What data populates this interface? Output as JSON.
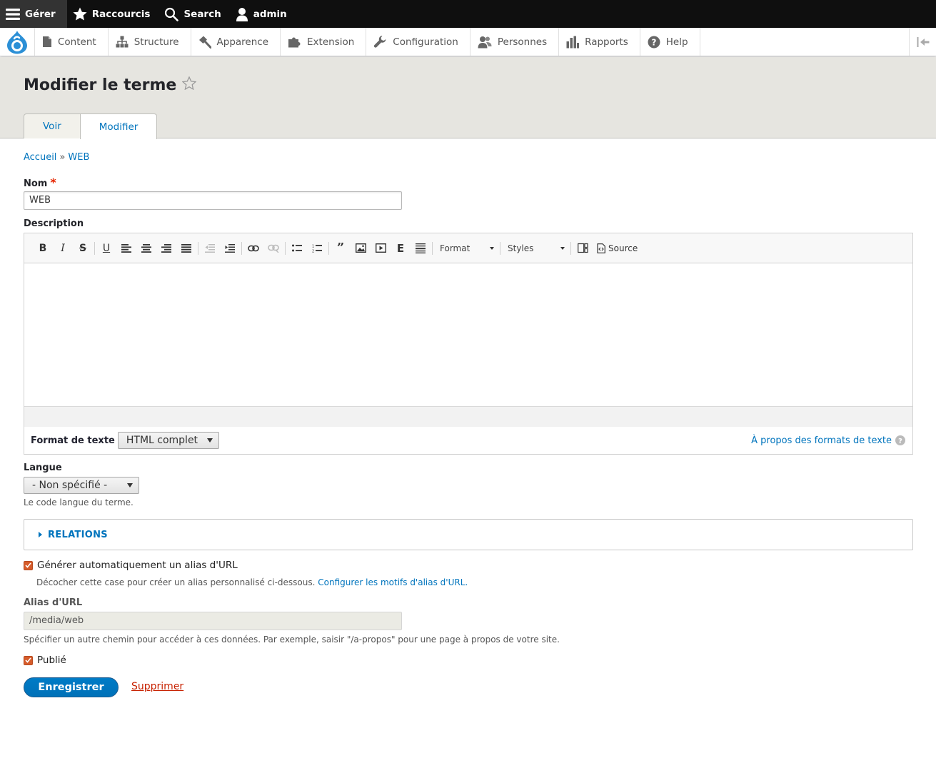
{
  "toolbar": {
    "manage": "Gérer",
    "shortcuts": "Raccourcis",
    "search": "Search",
    "user": "admin"
  },
  "tray": {
    "items": [
      {
        "label": "Content",
        "icon": "file-icon"
      },
      {
        "label": "Structure",
        "icon": "sitemap-icon"
      },
      {
        "label": "Apparence",
        "icon": "paintbrush-icon"
      },
      {
        "label": "Extension",
        "icon": "puzzle-icon"
      },
      {
        "label": "Configuration",
        "icon": "wrench-icon"
      },
      {
        "label": "Personnes",
        "icon": "people-icon"
      },
      {
        "label": "Rapports",
        "icon": "bar-chart-icon"
      },
      {
        "label": "Help",
        "icon": "help-icon"
      }
    ]
  },
  "page": {
    "title": "Modifier le terme",
    "tabs": [
      {
        "label": "Voir",
        "active": false
      },
      {
        "label": "Modifier",
        "active": true
      }
    ]
  },
  "breadcrumb": {
    "home": "Accueil",
    "separator": "»",
    "current": "WEB"
  },
  "form": {
    "name_label": "Nom",
    "required_mark": "*",
    "name_value": "WEB",
    "description_label": "Description",
    "editor_format_combo": "Format",
    "editor_styles_combo": "Styles",
    "editor_source": "Source",
    "text_format_label": "Format de texte",
    "text_format_value": "HTML complet",
    "text_format_help": "À propos des formats de texte",
    "language_label": "Langue",
    "language_value": "- Non spécifié -",
    "language_description": "Le code langue du terme.",
    "relations_title": "RELATIONS",
    "pathauto_label": "Générer automatiquement un alias d'URL",
    "pathauto_checked": true,
    "pathauto_description": "Décocher cette case pour créer un alias personnalisé ci-dessous.",
    "pathauto_link": "Configurer les motifs d'alias d'URL.",
    "alias_label": "Alias d'URL",
    "alias_value": "/media/web",
    "alias_description": "Spécifier un autre chemin pour accéder à ces données. Par exemple, saisir \"/a-propos\" pour une page à propos de votre site.",
    "published_label": "Publié",
    "published_checked": true,
    "save_button": "Enregistrer",
    "delete_link": "Supprimer"
  },
  "colors": {
    "accent": "#0074bd",
    "checkbox": "#d65c2b",
    "delete": "#c72100",
    "header_bg": "#e6e5e0"
  }
}
